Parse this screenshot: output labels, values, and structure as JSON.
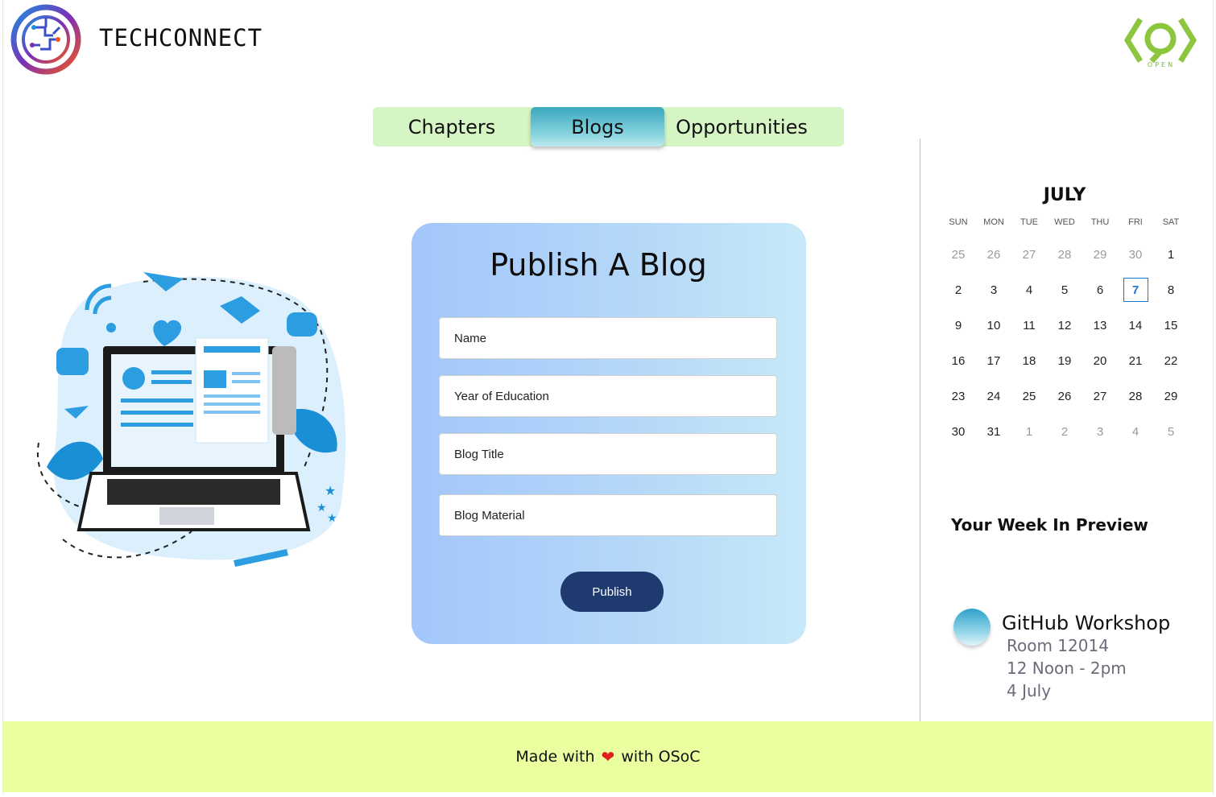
{
  "header": {
    "brand": "TECHCONNECT",
    "partner_logo_text": "OPEN"
  },
  "tabs": [
    {
      "label": "Chapters"
    },
    {
      "label": "Blogs",
      "active": true
    },
    {
      "label": "Opportunities"
    }
  ],
  "form": {
    "title": "Publish A Blog",
    "fields": [
      {
        "placeholder": "Name"
      },
      {
        "placeholder": "Year of Education"
      },
      {
        "placeholder": "Blog Title"
      },
      {
        "placeholder": "Blog Material"
      }
    ],
    "submit_label": "Publish"
  },
  "calendar": {
    "month": "JULY",
    "weekdays": [
      "SUN",
      "MON",
      "TUE",
      "WED",
      "THU",
      "FRI",
      "SAT"
    ],
    "weeks": [
      [
        "25",
        "26",
        "27",
        "28",
        "29",
        "30",
        "1"
      ],
      [
        "2",
        "3",
        "4",
        "5",
        "6",
        "7",
        "8"
      ],
      [
        "9",
        "10",
        "11",
        "12",
        "13",
        "14",
        "15"
      ],
      [
        "16",
        "17",
        "18",
        "19",
        "20",
        "21",
        "22"
      ],
      [
        "23",
        "24",
        "25",
        "26",
        "27",
        "28",
        "29"
      ],
      [
        "30",
        "31",
        "1",
        "2",
        "3",
        "4",
        "5"
      ]
    ],
    "selected_day": "7"
  },
  "preview": {
    "title": "Your Week In Preview",
    "event": {
      "title": "GitHub Workshop",
      "room": "Room 12014",
      "time": "12 Noon - 2pm",
      "date": "4 July"
    }
  },
  "footer": {
    "prefix": "Made with",
    "suffix": "with OSoC"
  },
  "colors": {
    "tab_bar": "#d6f5c4",
    "active_tab": "#3aa8bd",
    "publish_button": "#1e3a6e",
    "footer_bg": "#eaffa0",
    "today_border": "#1976d2"
  }
}
